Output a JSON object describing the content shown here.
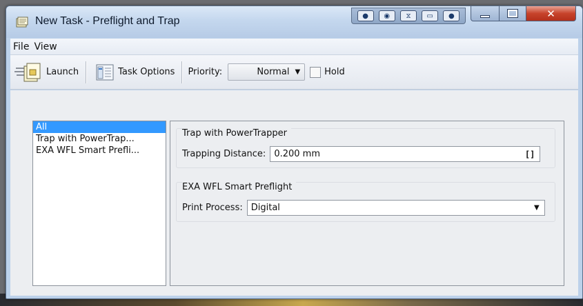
{
  "window": {
    "title": "New Task - Preflight and Trap"
  },
  "menu": [
    "File",
    "View"
  ],
  "toolbar": {
    "launch_label": "Launch",
    "options_label": "Task Options",
    "priority_label": "Priority:",
    "priority_value": "Normal",
    "hold_label": "Hold"
  },
  "tree": [
    "All",
    "Trap with PowerTrap...",
    "EXA WFL Smart Prefli..."
  ],
  "trap_group": {
    "title": "Trap with PowerTrapper",
    "distance_label": "Trapping Distance:",
    "distance_value": "0.200 mm",
    "unit_button": "[]"
  },
  "preflight_group": {
    "title": "EXA WFL Smart Preflight",
    "process_label": "Print Process:",
    "process_value": "Digital"
  },
  "icons": [
    "task-doc-icon",
    "launch-icon",
    "task-options-icon",
    "dropdown-caret-icon"
  ]
}
